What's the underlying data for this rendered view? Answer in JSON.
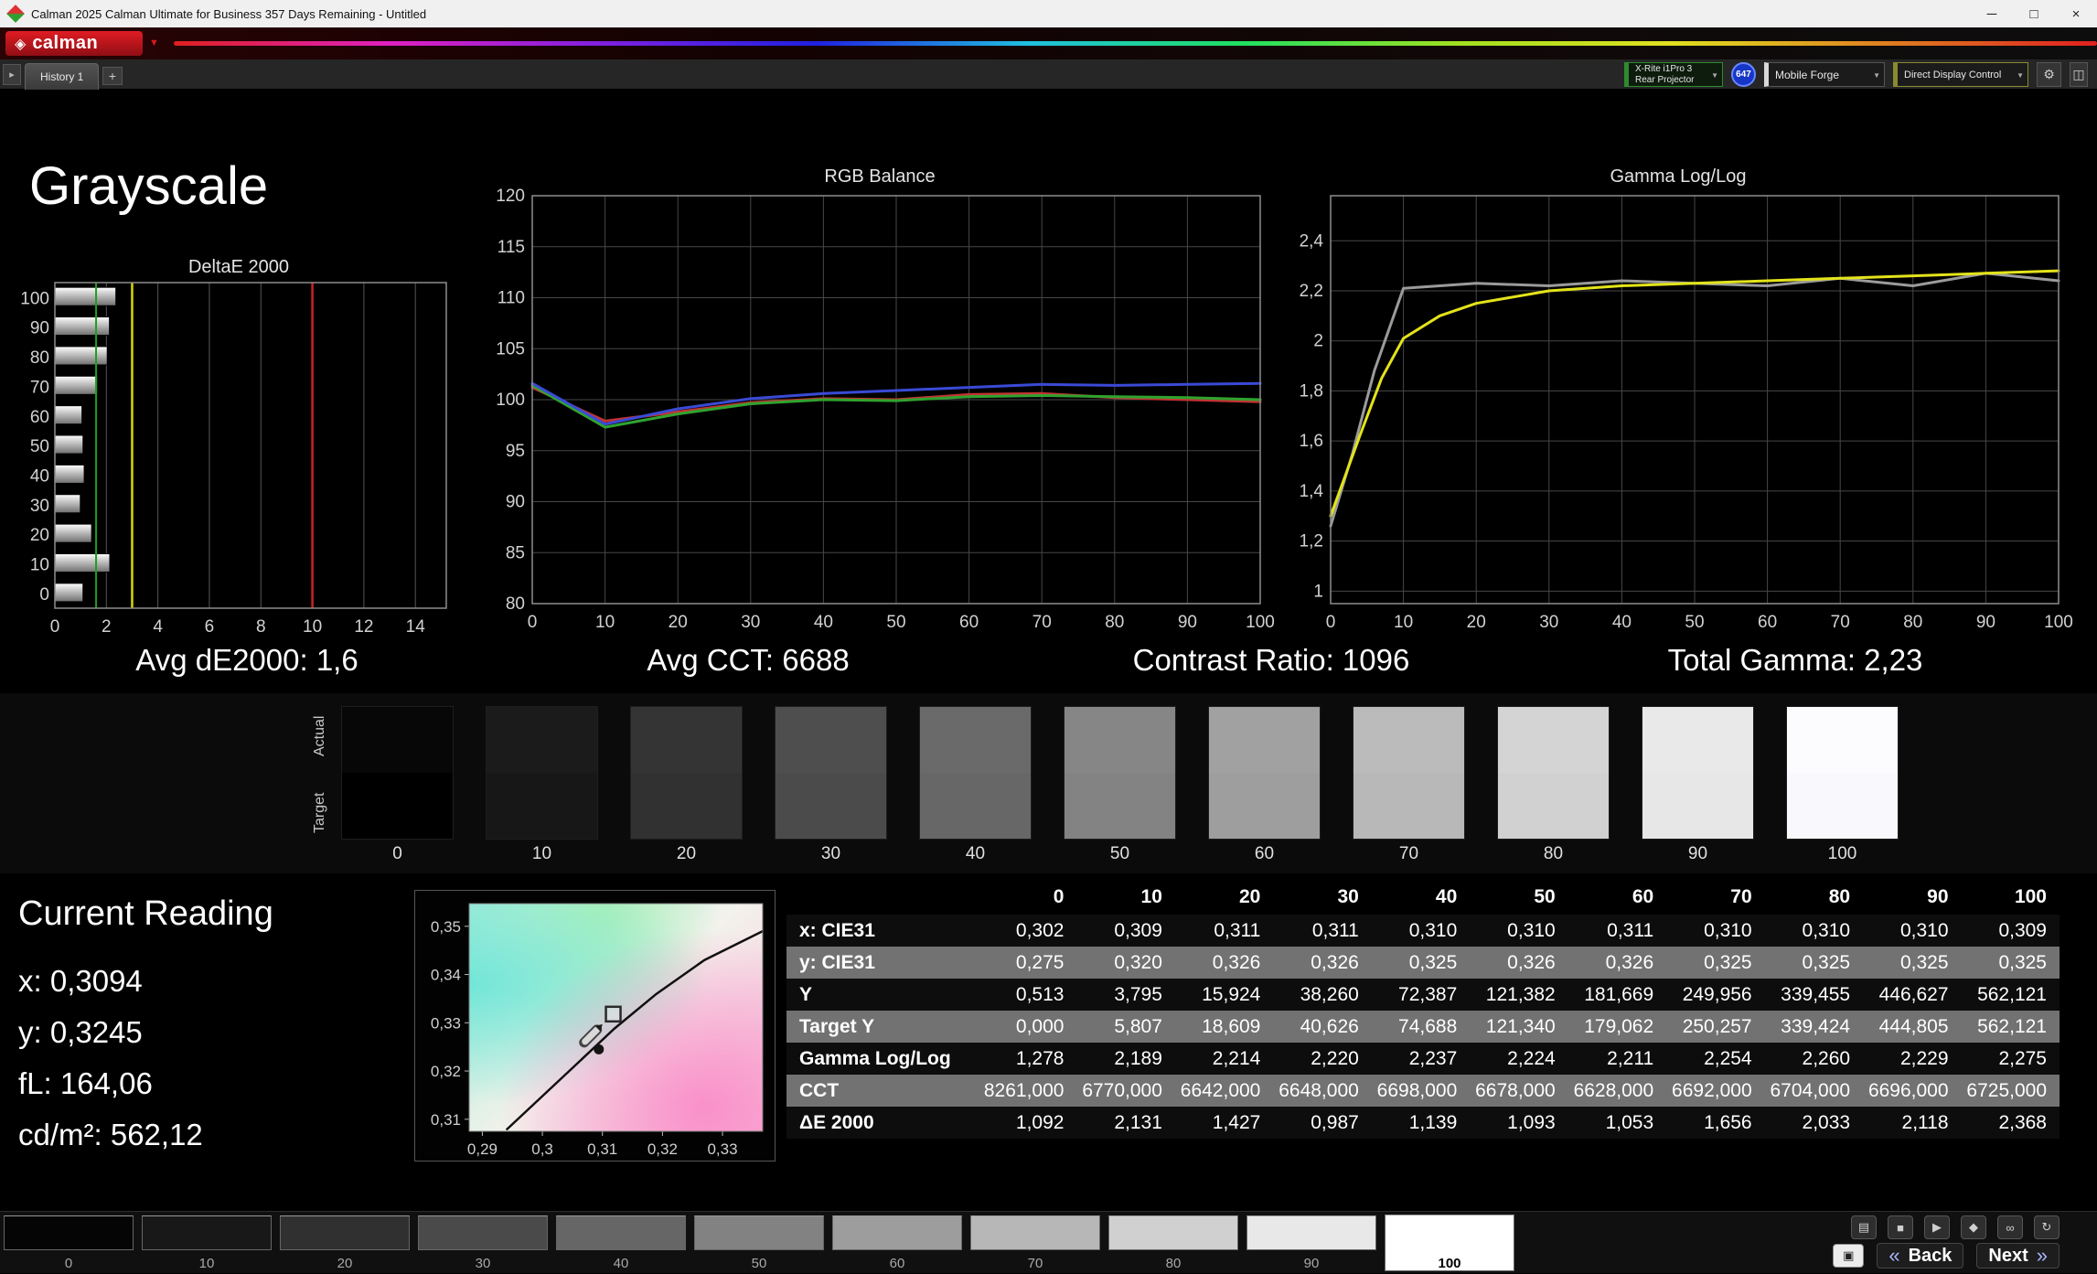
{
  "window": {
    "title": "Calman 2025 Calman Ultimate for Business 357 Days Remaining  - Untitled"
  },
  "brand": {
    "name": "calman"
  },
  "toolbar": {
    "history_tab": "History 1",
    "add_tab": "+",
    "meter_line1": "X-Rite i1Pro 3",
    "meter_line2": "Rear Projector",
    "meter_badge": "647",
    "source": "Mobile Forge",
    "display_control": "Direct Display Control"
  },
  "page": {
    "title": "Grayscale"
  },
  "summary": {
    "avg_de": "Avg dE2000: 1,6",
    "avg_cct": "Avg CCT: 6688",
    "contrast": "Contrast Ratio: 1096",
    "total_gamma": "Total Gamma: 2,23"
  },
  "swatches": {
    "actual_label": "Actual",
    "target_label": "Target",
    "levels": [
      {
        "label": "0",
        "actual": "#070707",
        "target": "#000000"
      },
      {
        "label": "10",
        "actual": "#1b1b1b",
        "target": "#171717"
      },
      {
        "label": "20",
        "actual": "#343434",
        "target": "#313131"
      },
      {
        "label": "30",
        "actual": "#4e4e4e",
        "target": "#4b4b4b"
      },
      {
        "label": "40",
        "actual": "#6a6a6a",
        "target": "#676767"
      },
      {
        "label": "50",
        "actual": "#868686",
        "target": "#838383"
      },
      {
        "label": "60",
        "actual": "#a1a1a1",
        "target": "#9e9e9e"
      },
      {
        "label": "70",
        "actual": "#bbbbbb",
        "target": "#b8b8b8"
      },
      {
        "label": "80",
        "actual": "#d4d4d4",
        "target": "#d1d1d1"
      },
      {
        "label": "90",
        "actual": "#e9e9e9",
        "target": "#e7e7e7"
      },
      {
        "label": "100",
        "actual": "#fcfcff",
        "target": "#f9f9fd"
      }
    ]
  },
  "current_reading": {
    "title": "Current Reading",
    "lines": [
      {
        "text": "x: 0,3094"
      },
      {
        "text": "y: 0,3245"
      },
      {
        "text": "fL: 164,06"
      },
      {
        "text": "cd/m²: 562,12"
      }
    ]
  },
  "table": {
    "columns": [
      "0",
      "10",
      "20",
      "30",
      "40",
      "50",
      "60",
      "70",
      "80",
      "90",
      "100"
    ],
    "rows": [
      {
        "label": "x: CIE31",
        "values": [
          "0,302",
          "0,309",
          "0,311",
          "0,311",
          "0,310",
          "0,310",
          "0,311",
          "0,310",
          "0,310",
          "0,310",
          "0,309"
        ]
      },
      {
        "label": "y: CIE31",
        "values": [
          "0,275",
          "0,320",
          "0,326",
          "0,326",
          "0,325",
          "0,326",
          "0,326",
          "0,325",
          "0,325",
          "0,325",
          "0,325"
        ]
      },
      {
        "label": "Y",
        "values": [
          "0,513",
          "3,795",
          "15,924",
          "38,260",
          "72,387",
          "121,382",
          "181,669",
          "249,956",
          "339,455",
          "446,627",
          "562,121"
        ]
      },
      {
        "label": "Target Y",
        "values": [
          "0,000",
          "5,807",
          "18,609",
          "40,626",
          "74,688",
          "121,340",
          "179,062",
          "250,257",
          "339,424",
          "444,805",
          "562,121"
        ]
      },
      {
        "label": "Gamma Log/Log",
        "values": [
          "1,278",
          "2,189",
          "2,214",
          "2,220",
          "2,237",
          "2,224",
          "2,211",
          "2,254",
          "2,260",
          "2,229",
          "2,275"
        ]
      },
      {
        "label": "CCT",
        "values": [
          "8261,000",
          "6770,000",
          "6642,000",
          "6648,000",
          "6698,000",
          "6678,000",
          "6628,000",
          "6692,000",
          "6704,000",
          "6696,000",
          "6725,000"
        ]
      },
      {
        "label": "ΔE 2000",
        "values": [
          "1,092",
          "2,131",
          "1,427",
          "0,987",
          "1,139",
          "1,093",
          "1,053",
          "1,656",
          "2,033",
          "2,118",
          "2,368"
        ]
      }
    ]
  },
  "bottom": {
    "back": "Back",
    "next": "Next",
    "patches": [
      {
        "label": "0",
        "color": "#050505"
      },
      {
        "label": "10",
        "color": "#181818"
      },
      {
        "label": "20",
        "color": "#303030"
      },
      {
        "label": "30",
        "color": "#4a4a4a"
      },
      {
        "label": "40",
        "color": "#666666"
      },
      {
        "label": "50",
        "color": "#828282"
      },
      {
        "label": "60",
        "color": "#9d9d9d"
      },
      {
        "label": "70",
        "color": "#b7b7b7"
      },
      {
        "label": "80",
        "color": "#d0d0d0"
      },
      {
        "label": "90",
        "color": "#e8e8e8"
      },
      {
        "label": "100",
        "color": "#ffffff",
        "selected": true
      }
    ]
  },
  "chart_data": [
    {
      "id": "deltae",
      "type": "bar",
      "title": "DeltaE 2000",
      "orientation": "horizontal",
      "categories": [
        "100",
        "90",
        "80",
        "70",
        "60",
        "50",
        "40",
        "30",
        "20",
        "10",
        "0"
      ],
      "values": [
        2.368,
        2.118,
        2.033,
        1.656,
        1.053,
        1.093,
        1.139,
        0.987,
        1.427,
        2.131,
        1.092
      ],
      "xlim": [
        0,
        15.2
      ],
      "xticks": [
        0,
        2,
        4,
        6,
        8,
        10,
        12,
        14
      ],
      "target_line": {
        "x": 3,
        "color": "#d8d800"
      },
      "limit_line": {
        "x": 10,
        "color": "#cc2222"
      },
      "avg_line": {
        "x": 1.6,
        "color": "#1e9e1e"
      }
    },
    {
      "id": "rgb",
      "type": "line",
      "title": "RGB Balance",
      "xlim": [
        0,
        100
      ],
      "ylim": [
        80,
        120
      ],
      "xticks": [
        0,
        10,
        20,
        30,
        40,
        50,
        60,
        70,
        80,
        90,
        100
      ],
      "yticks": [
        80,
        85,
        90,
        95,
        100,
        105,
        110,
        115,
        120
      ],
      "series": [
        {
          "name": "Red",
          "color": "#c23333",
          "x": [
            0,
            10,
            20,
            30,
            40,
            50,
            60,
            70,
            80,
            90,
            100
          ],
          "values": [
            101.2,
            97.9,
            98.8,
            99.7,
            100.1,
            100.0,
            100.5,
            100.6,
            100.2,
            100.0,
            99.8
          ]
        },
        {
          "name": "Green",
          "color": "#2fa32f",
          "x": [
            0,
            10,
            20,
            30,
            40,
            50,
            60,
            70,
            80,
            90,
            100
          ],
          "values": [
            101.4,
            97.3,
            98.6,
            99.6,
            100.0,
            99.9,
            100.3,
            100.4,
            100.3,
            100.2,
            100.0
          ]
        },
        {
          "name": "Blue",
          "color": "#3a4ad6",
          "x": [
            0,
            10,
            20,
            30,
            40,
            50,
            60,
            70,
            80,
            90,
            100
          ],
          "values": [
            101.6,
            97.6,
            99.1,
            100.1,
            100.6,
            100.9,
            101.2,
            101.5,
            101.4,
            101.5,
            101.6
          ]
        }
      ]
    },
    {
      "id": "gamma",
      "type": "line",
      "title": "Gamma Log/Log",
      "xlim": [
        0,
        100
      ],
      "ylim": [
        0.95,
        2.58
      ],
      "xticks": [
        0,
        10,
        20,
        30,
        40,
        50,
        60,
        70,
        80,
        90,
        100
      ],
      "yticks": [
        {
          "v": 1,
          "t": "1"
        },
        {
          "v": 1.2,
          "t": "1,2"
        },
        {
          "v": 1.4,
          "t": "1,4"
        },
        {
          "v": 1.6,
          "t": "1,6"
        },
        {
          "v": 1.8,
          "t": "1,8"
        },
        {
          "v": 2,
          "t": "2"
        },
        {
          "v": 2.2,
          "t": "2,2"
        },
        {
          "v": 2.4,
          "t": "2,4"
        }
      ],
      "series": [
        {
          "name": "Target",
          "color": "#9b9b9b",
          "x": [
            0,
            3,
            6,
            10,
            20,
            30,
            40,
            50,
            60,
            70,
            80,
            90,
            100
          ],
          "values": [
            1.26,
            1.55,
            1.88,
            2.21,
            2.23,
            2.22,
            2.24,
            2.23,
            2.22,
            2.25,
            2.22,
            2.27,
            2.24
          ]
        },
        {
          "name": "Measured",
          "color": "#e3e31a",
          "x": [
            0,
            2,
            4,
            7,
            10,
            15,
            20,
            30,
            40,
            50,
            60,
            70,
            80,
            90,
            100
          ],
          "values": [
            1.3,
            1.46,
            1.62,
            1.85,
            2.01,
            2.1,
            2.15,
            2.2,
            2.22,
            2.23,
            2.24,
            2.25,
            2.26,
            2.27,
            2.28
          ]
        }
      ]
    },
    {
      "id": "cie",
      "type": "scatter",
      "title": "CIE xy chromaticity",
      "xlim": [
        0.2878,
        0.3367
      ],
      "ylim": [
        0.3075,
        0.3547
      ],
      "xticks": [
        {
          "v": 0.29,
          "t": "0,29"
        },
        {
          "v": 0.3,
          "t": "0,3"
        },
        {
          "v": 0.31,
          "t": "0,31"
        },
        {
          "v": 0.32,
          "t": "0,32"
        },
        {
          "v": 0.33,
          "t": "0,33"
        }
      ],
      "yticks": [
        {
          "v": 0.35,
          "t": "0,35"
        },
        {
          "v": 0.34,
          "t": "0,34"
        },
        {
          "v": 0.33,
          "t": "0,33"
        },
        {
          "v": 0.32,
          "t": "0,32"
        },
        {
          "v": 0.31,
          "t": "0,31"
        }
      ],
      "locus": [
        [
          0.294,
          0.3078
        ],
        [
          0.3,
          0.3148
        ],
        [
          0.306,
          0.3218
        ],
        [
          0.312,
          0.3288
        ],
        [
          0.319,
          0.336
        ],
        [
          0.327,
          0.343
        ],
        [
          0.3367,
          0.349
        ]
      ],
      "target_marker": {
        "x": 0.3118,
        "y": 0.3318
      },
      "measured_marker": {
        "x": 0.3094,
        "y": 0.3245
      },
      "cursor": {
        "x": 0.31,
        "y": 0.3297
      }
    }
  ]
}
